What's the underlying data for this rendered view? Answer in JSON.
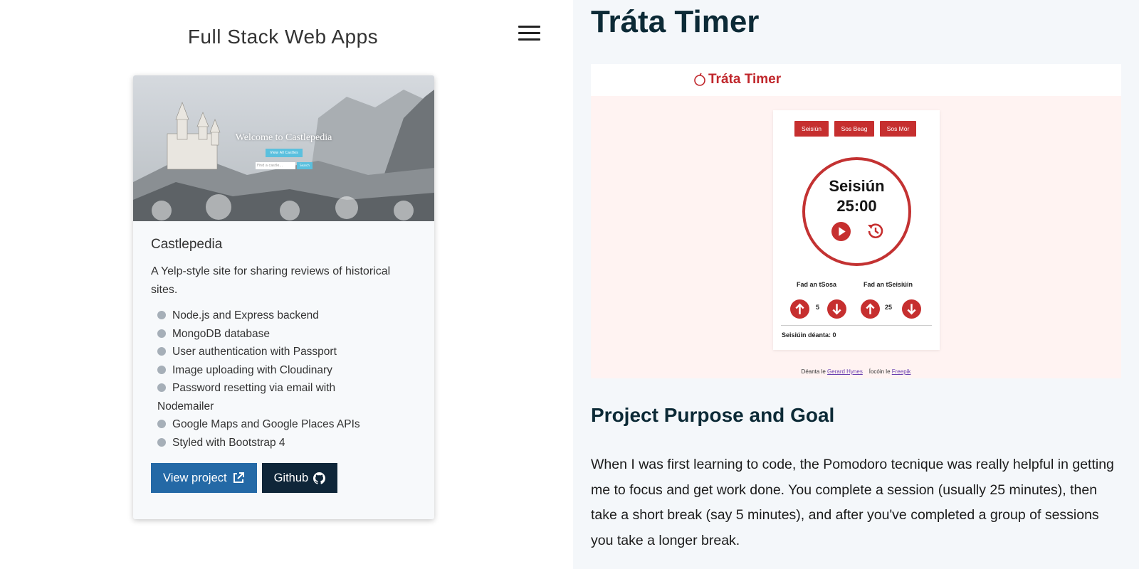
{
  "site": {
    "title": "Full Stack Web Apps",
    "menu_icon": "hamburger-menu-icon"
  },
  "card": {
    "image": {
      "heading": "Welcome to Castlepedia",
      "button": "View All Castles",
      "search_placeholder": "Find a castle...",
      "search_button": "Search"
    },
    "title": "Castlepedia",
    "description": "A Yelp-style site for sharing reviews of historical sites.",
    "features": [
      "Node.js and Express backend",
      "MongoDB database",
      "User authentication with Passport",
      "Image uploading with Cloudinary",
      "Password resetting via email with Nodemailer",
      "Google Maps and Google Places APIs",
      "Styled with Bootstrap 4"
    ],
    "view_label": "View project",
    "github_label": "Github"
  },
  "project": {
    "title": "Tráta Timer",
    "screenshot": {
      "logo": "Tráta Timer",
      "modes": [
        "Seisiún",
        "Sos Beag",
        "Sos Mór"
      ],
      "current_mode": "Seisiún",
      "time": "25:00",
      "break_label": "Fad an tSosa",
      "break_value": "5",
      "session_label": "Fad an tSeisiúin",
      "session_value": "25",
      "done_label": "Seisiúin déanta: 0",
      "credit_made_by": "Déanta le",
      "credit_author": "Gerard Hynes",
      "credit_icons_by": "Íocóin le",
      "credit_freepik": "Freepik"
    },
    "purpose_heading": "Project Purpose and Goal",
    "purpose_text": "When I was first learning to code, the Pomodoro tecnique was really helpful in getting me to focus and get work done. You complete a session (usually 25 minutes), then take a short break (say 5 minutes), and after you've completed a group of sessions you take a longer break."
  },
  "colors": {
    "view_button": "#2469a6",
    "github_button": "#0f2639",
    "tomato_red": "#c62f2f",
    "heading": "#0c2a36"
  }
}
